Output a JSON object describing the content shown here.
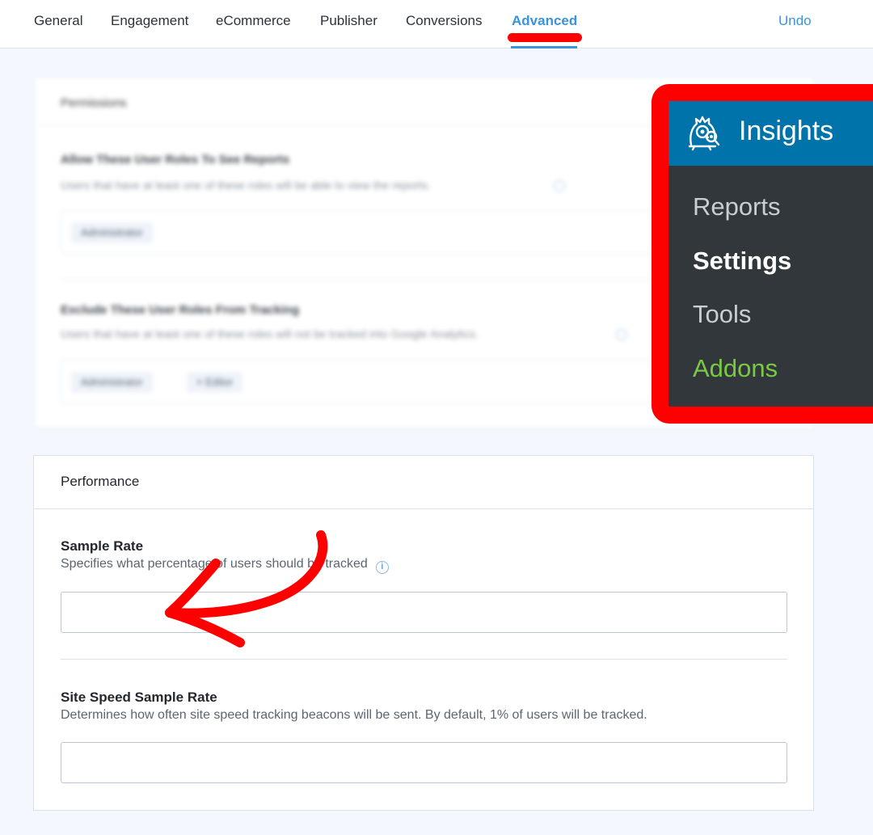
{
  "tabs": [
    {
      "label": "General",
      "active": false
    },
    {
      "label": "Engagement",
      "active": false
    },
    {
      "label": "eCommerce",
      "active": false
    },
    {
      "label": "Publisher",
      "active": false
    },
    {
      "label": "Conversions",
      "active": false
    },
    {
      "label": "Advanced",
      "active": true
    }
  ],
  "undo_label": "Undo",
  "permissions": {
    "title": "Permissions",
    "view_reports": {
      "label": "Allow These User Roles To See Reports",
      "description": "Users that have at least one of these roles will be able to view the reports.",
      "roles": [
        "Administrator"
      ]
    },
    "exclude_tracking": {
      "label": "Exclude These User Roles From Tracking",
      "description": "Users that have at least one of these roles will not be tracked into Google Analytics.",
      "roles": [
        "Administrator",
        "× Editor"
      ]
    }
  },
  "insights_menu": {
    "title": "Insights",
    "logo_icon": "insights-monster-icon",
    "items": [
      {
        "label": "Reports",
        "state": "normal"
      },
      {
        "label": "Settings",
        "state": "current"
      },
      {
        "label": "Tools",
        "state": "normal"
      },
      {
        "label": "Addons",
        "state": "highlight"
      }
    ]
  },
  "performance": {
    "title": "Performance",
    "sample_rate": {
      "label": "Sample Rate",
      "description": "Specifies what percentage of users should be tracked",
      "info_icon": "info-icon",
      "value": ""
    },
    "site_speed_sample_rate": {
      "label": "Site Speed Sample Rate",
      "description": "Determines how often site speed tracking beacons will be sent. By default, 1% of users will be tracked.",
      "value": ""
    }
  },
  "colors": {
    "accent": "#3a93dd",
    "annotation": "#ff0000",
    "menu_header": "#0073aa",
    "menu_bg": "#32373c",
    "addons": "#7ac943"
  }
}
